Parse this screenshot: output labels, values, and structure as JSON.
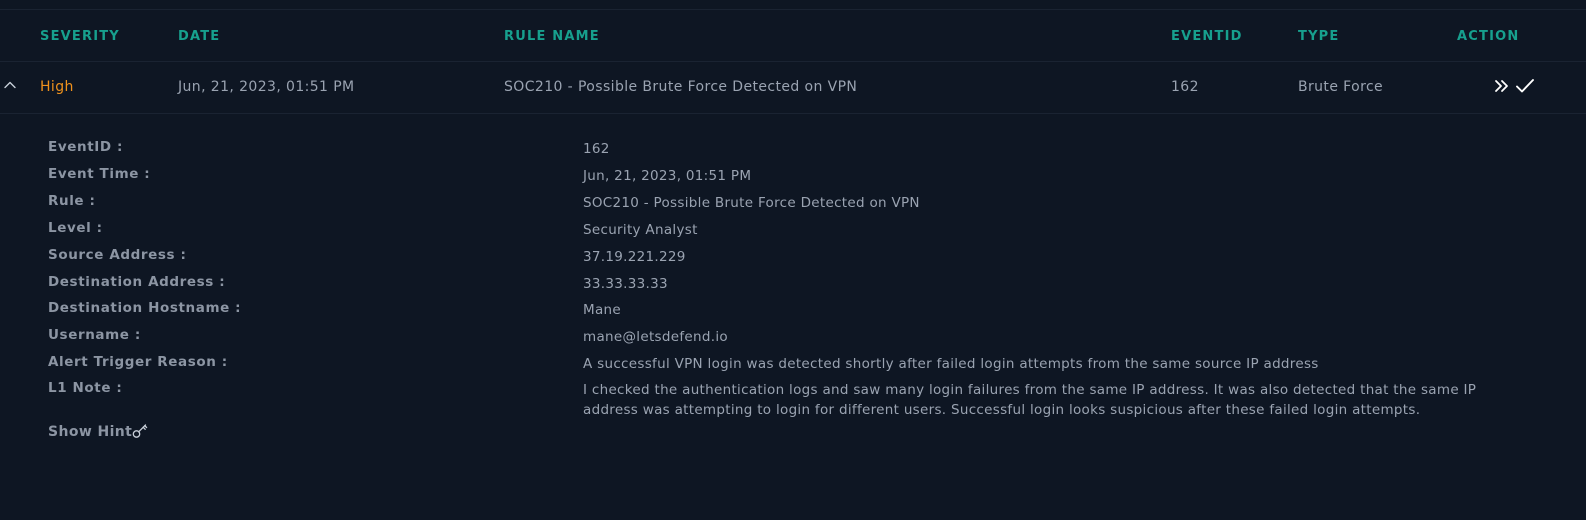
{
  "table": {
    "columns": {
      "severity": "SEVERITY",
      "date": "DATE",
      "rule_name": "RULE NAME",
      "eventid": "EVENTID",
      "type": "TYPE",
      "action": "ACTION"
    },
    "alert": {
      "severity": "High",
      "date": "Jun, 21, 2023, 01:51 PM",
      "rule_name": "SOC210 - Possible Brute Force Detected on VPN",
      "eventid": "162",
      "type": "Brute Force"
    }
  },
  "details": {
    "rows": [
      {
        "label": "EventID :",
        "value": "162"
      },
      {
        "label": "Event Time :",
        "value": "Jun, 21, 2023, 01:51 PM"
      },
      {
        "label": "Rule :",
        "value": "SOC210 - Possible Brute Force Detected on VPN"
      },
      {
        "label": "Level :",
        "value": "Security Analyst"
      },
      {
        "label": "Source Address :",
        "value": "37.19.221.229"
      },
      {
        "label": "Destination Address :",
        "value": "33.33.33.33"
      },
      {
        "label": "Destination Hostname :",
        "value": "Mane"
      },
      {
        "label": "Username :",
        "value": "mane@letsdefend.io"
      },
      {
        "label": "Alert Trigger Reason :",
        "value": "A successful VPN login was detected shortly after failed login attempts from the same source IP address"
      },
      {
        "label": "L1 Note :",
        "value": "I checked the authentication logs and saw many login failures from the same IP address. It was also detected that the same IP address was attempting to login for different users. Successful login looks suspicious after these failed login attempts."
      }
    ],
    "show_hint_label": "Show Hint"
  },
  "icons": {
    "expand": "chevron-up-icon",
    "take_ownership": "double-chevron-right-icon",
    "close_alert": "checkmark-icon",
    "hint": "key-icon"
  },
  "colors": {
    "background": "#0e1623",
    "header_accent": "#17a08e",
    "severity_high": "#f0921c",
    "text": "#9aa3b1",
    "label": "#8c95a3"
  }
}
